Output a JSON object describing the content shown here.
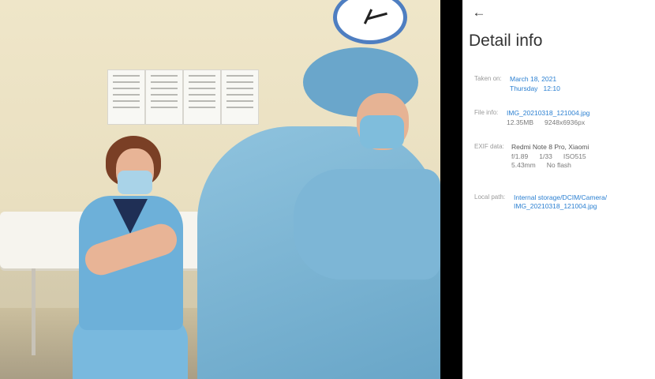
{
  "screen": {
    "accent_color": "#2a7fd1",
    "back_icon": "arrow-left-icon",
    "title": "Detail info"
  },
  "photo": {
    "description_icon": "photo"
  },
  "details": {
    "taken_on": {
      "label": "Taken on:",
      "date": "March 18, 2021",
      "day": "Thursday",
      "time": "12:10"
    },
    "file_info": {
      "label": "File info:",
      "filename": "IMG_20210318_121004.jpg",
      "size": "12.35MB",
      "resolution": "9248x6936px"
    },
    "exif_data": {
      "label": "EXIF data:",
      "device": "Redmi Note 8 Pro, Xiaomi",
      "aperture": "f/1.89",
      "shutter": "1/33",
      "iso": "ISO515",
      "focal_length": "5.43mm",
      "flash": "No flash"
    },
    "local_path": {
      "label": "Local path:",
      "line1": "Internal storage/DCIM/Camera/",
      "line2": "IMG_20210318_121004.jpg"
    }
  }
}
